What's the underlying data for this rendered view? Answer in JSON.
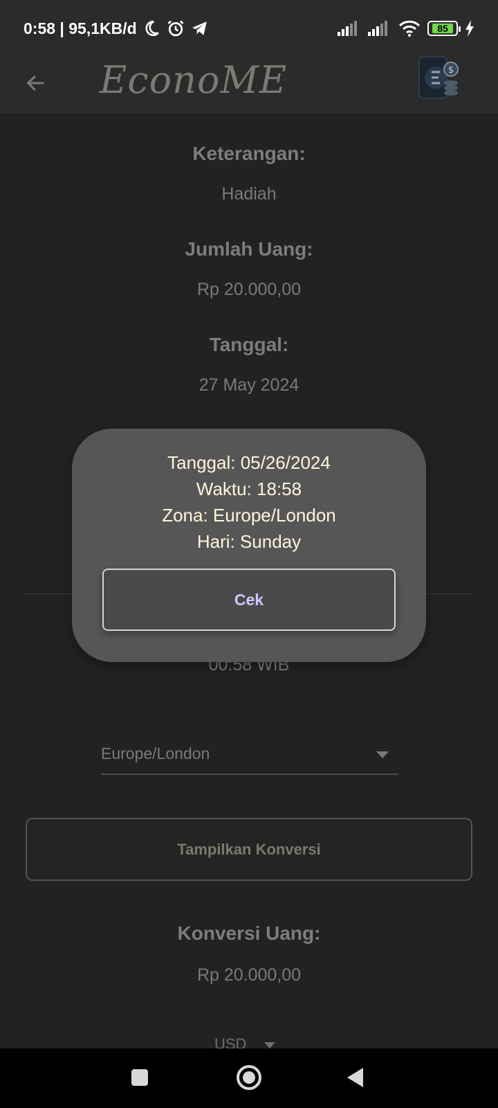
{
  "status_bar": {
    "time_speed": "0:58 | 95,1KB/d",
    "battery_level": "85",
    "icons": [
      "moon-icon",
      "alarm-icon",
      "telegram-icon",
      "signal-icon",
      "signal-icon",
      "wifi-icon",
      "battery-icon",
      "charging-icon"
    ]
  },
  "app_bar": {
    "title": "EconoME",
    "back_icon": "arrow-left-icon",
    "logo_icon": "wallet-coins-icon"
  },
  "details": {
    "keterangan_label": "Keterangan:",
    "keterangan_value": "Hadiah",
    "jumlah_label": "Jumlah Uang:",
    "jumlah_value": "Rp 20.000,00",
    "tanggal_label": "Tanggal:",
    "tanggal_value": "27 May 2024",
    "time_value": "00:58 WIB"
  },
  "timezone_dropdown": {
    "selected": "Europe/London"
  },
  "convert_button": {
    "label": "Tampilkan Konversi"
  },
  "conversion": {
    "label": "Konversi Uang:",
    "value": "Rp 20.000,00",
    "currency_selected": "USD"
  },
  "dialog": {
    "line_date": "Tanggal: 05/26/2024",
    "line_time": "Waktu: 18:58",
    "line_zone": "Zona: Europe/London",
    "line_day": "Hari: Sunday",
    "button_label": "Cek"
  },
  "colors": {
    "background": "#222222",
    "dialog": "#565656",
    "dialog_text": "#fff6dc",
    "accent_button_text": "#d4c6ff",
    "battery": "#6fd84b"
  }
}
